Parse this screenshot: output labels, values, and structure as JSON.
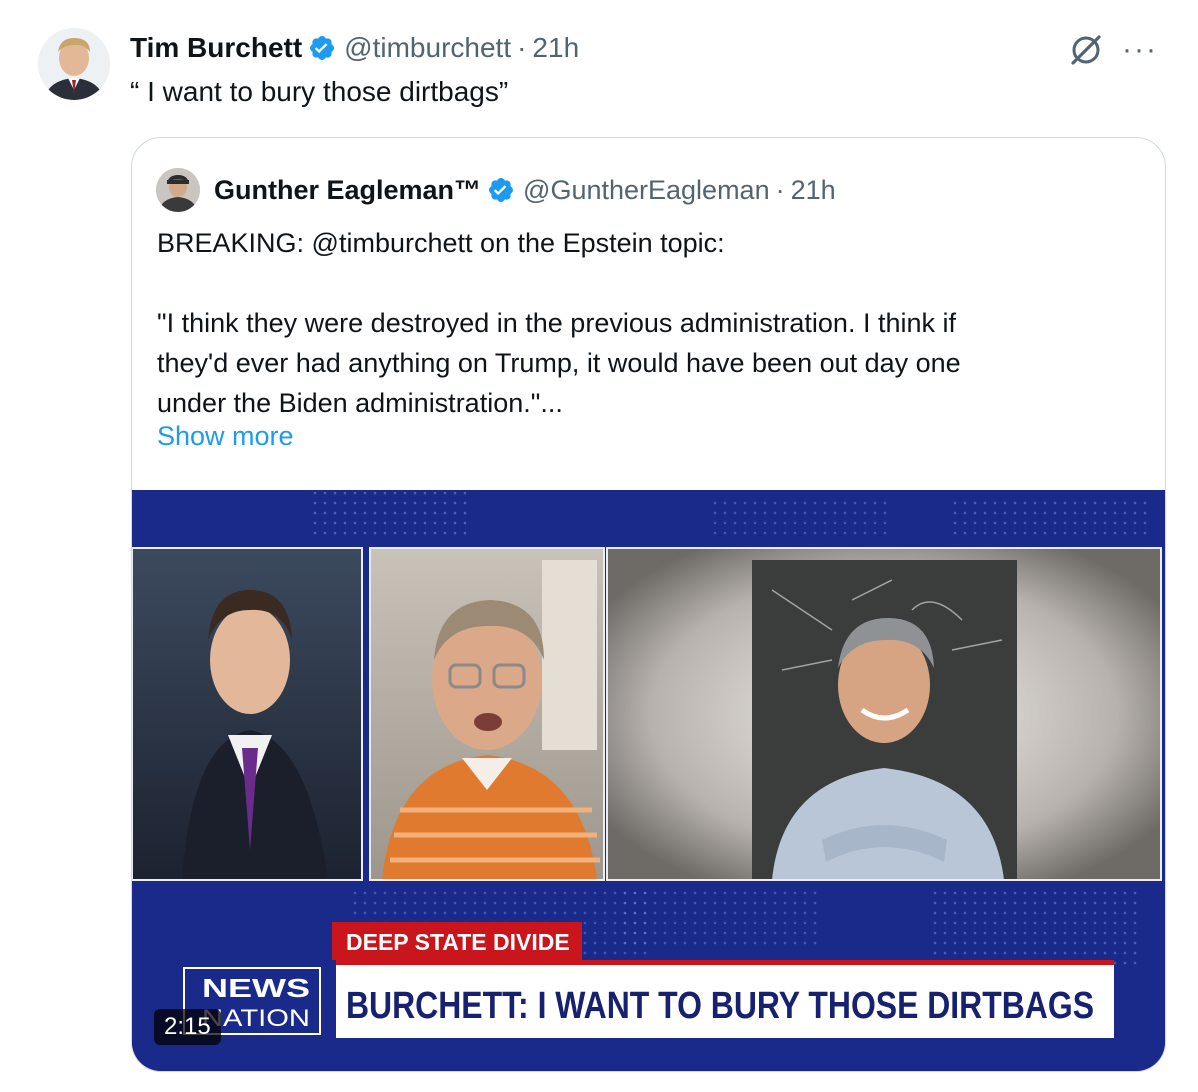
{
  "tweet": {
    "author_name": "Tim Burchett",
    "author_handle": "@timburchett",
    "separator": "·",
    "time": "21h",
    "text": "“ I want to bury those dirtbags”"
  },
  "quote": {
    "author_name": "Gunther Eagleman™",
    "author_handle": "@GuntherEagleman",
    "separator": "·",
    "time": "21h",
    "lines": [
      "BREAKING: @timburchett on the Epstein topic:",
      "",
      "\"I think they were destroyed in the previous administration. I think if",
      "they'd ever had anything on Trump, it would have been out day one",
      "under the Biden administration.\"..."
    ],
    "show_more": "Show more"
  },
  "video": {
    "lower_third_tag": "DEEP STATE DIVIDE",
    "headline": "BURCHETT: I WANT TO BURY THOSE DIRTBAGS",
    "logo_top": "NEWS",
    "logo_bottom": "NATION",
    "duration": "2:15"
  },
  "icons": {
    "verified": "verified-badge-icon",
    "grok": "grok-icon",
    "more": "more-icon"
  },
  "colors": {
    "verified_blue": "#1d9bf0",
    "link_blue": "#1d9bf0",
    "secondary_text": "#536471",
    "newsnation_blue": "#1a2a8a",
    "lower_third_red": "#c9161d"
  }
}
